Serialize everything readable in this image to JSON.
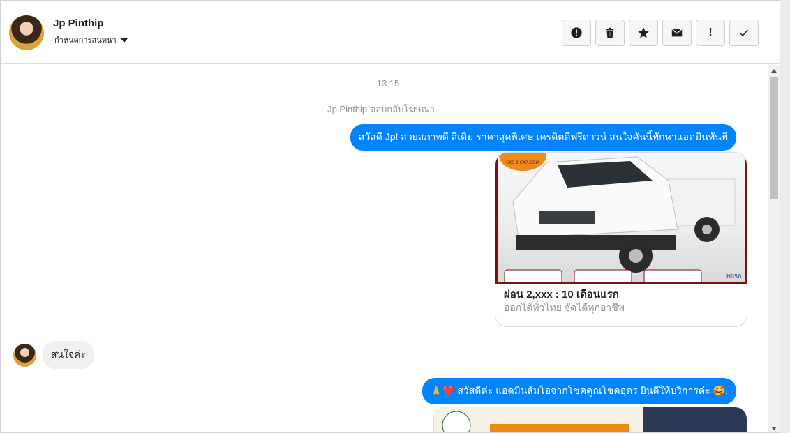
{
  "header": {
    "contact_name": "Jp Pinthip",
    "conversation_label": "กำหนดการสนทนา"
  },
  "toolbar": {
    "buttons": [
      {
        "icon": "alert-circle-icon"
      },
      {
        "icon": "trash-icon"
      },
      {
        "icon": "star-icon"
      },
      {
        "icon": "envelope-icon"
      },
      {
        "label": "!"
      },
      {
        "icon": "check-icon"
      }
    ]
  },
  "messages": {
    "timestamp": "13:15",
    "system_note": "Jp Pinthip ตอบกลับโฆษณา",
    "outgoing_1": "สวัสดี Jp! สวยสภาพดี สีเดิม ราคาสุดพิเศษ เครดิตดีฟรีดาวน์  สนใจคันนี้ทักหาแอดมินทันที",
    "card": {
      "title": "ผ่อน 2,xxx : 10 เดือนแรก",
      "subtitle": "ออกได้ทั่วไทย จัดได้ทุกอาชีพ",
      "image_badge": "CKC 2 CAR.COM",
      "image_code": "H050"
    },
    "incoming_1": "สนใจค่ะ",
    "outgoing_2": "🙏❤️ สวัสดีค่ะ แอดมินส้มโอจากโชคคูณโชคอุดร ยินดีให้บริการค่ะ 🥰."
  },
  "colors": {
    "accent": "#0084ff",
    "incoming_bubble": "#f0f0f0",
    "muted_text": "#8d949e"
  }
}
